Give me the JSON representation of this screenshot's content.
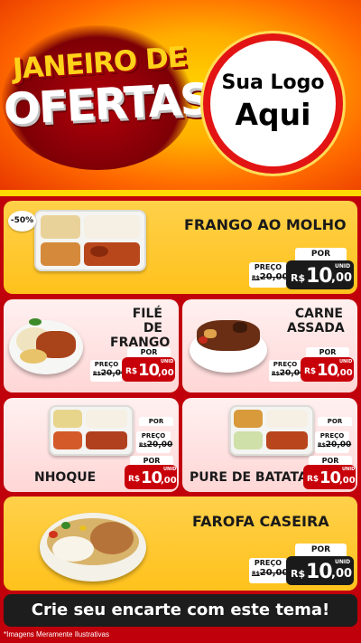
{
  "header": {
    "title_line1": "JANEIRO DE",
    "title_line2": "OFERTAS",
    "logo_line1": "Sua Logo",
    "logo_line2": "Aqui"
  },
  "discount_badge": "-50%",
  "products": [
    {
      "name": "FRANGO AO MOLHO",
      "preco_label": "PREÇO",
      "old_currency": "R$",
      "old_price": "20,00",
      "por_label": "POR",
      "currency": "R$",
      "price_int": "10",
      "price_cents": ",00",
      "unit": "UNID"
    },
    {
      "name": "FILÉ DE FRANGO",
      "preco_label": "PREÇO",
      "old_currency": "R$",
      "old_price": "20,00",
      "por_label": "POR",
      "currency": "R$",
      "price_int": "10",
      "price_cents": ",00",
      "unit": "UNID"
    },
    {
      "name": "CARNE ASSADA",
      "preco_label": "PREÇO",
      "old_currency": "R$",
      "old_price": "20,00",
      "por_label": "POR",
      "currency": "R$",
      "price_int": "10",
      "price_cents": ",00",
      "unit": "UNID"
    },
    {
      "name": "NHOQUE",
      "preco_label": "PREÇO",
      "old_currency": "R$",
      "old_price": "20,00",
      "por_label": "POR",
      "currency": "R$",
      "price_int": "10",
      "price_cents": ",00",
      "unit": "UNID"
    },
    {
      "name": "PURE DE BATATA",
      "preco_label": "PREÇO",
      "old_currency": "R$",
      "old_price": "20,00",
      "por_label": "POR",
      "currency": "R$",
      "price_int": "10",
      "price_cents": ",00",
      "unit": "UNID"
    },
    {
      "name": "FAROFA CASEIRA",
      "preco_label": "PREÇO",
      "old_currency": "R$",
      "old_price": "20,00",
      "por_label": "POR",
      "currency": "R$",
      "price_int": "10",
      "price_cents": ",00",
      "unit": "UNID"
    }
  ],
  "name_lines": {
    "file_l1": "FILÉ DE",
    "file_l2": "FRANGO",
    "carne_l1": "CARNE",
    "carne_l2": "ASSADA"
  },
  "cta": "Crie seu encarte com este tema!",
  "footer_note": "*Imagens Meramente Ilustrativas",
  "colors": {
    "background_red": "#c0000b",
    "card_yellow": "#ffc21c",
    "card_pink": "#ffe0e0",
    "price_black": "#1a1a1a",
    "price_red": "#c8000a",
    "accent_yellow": "#ffd800"
  }
}
